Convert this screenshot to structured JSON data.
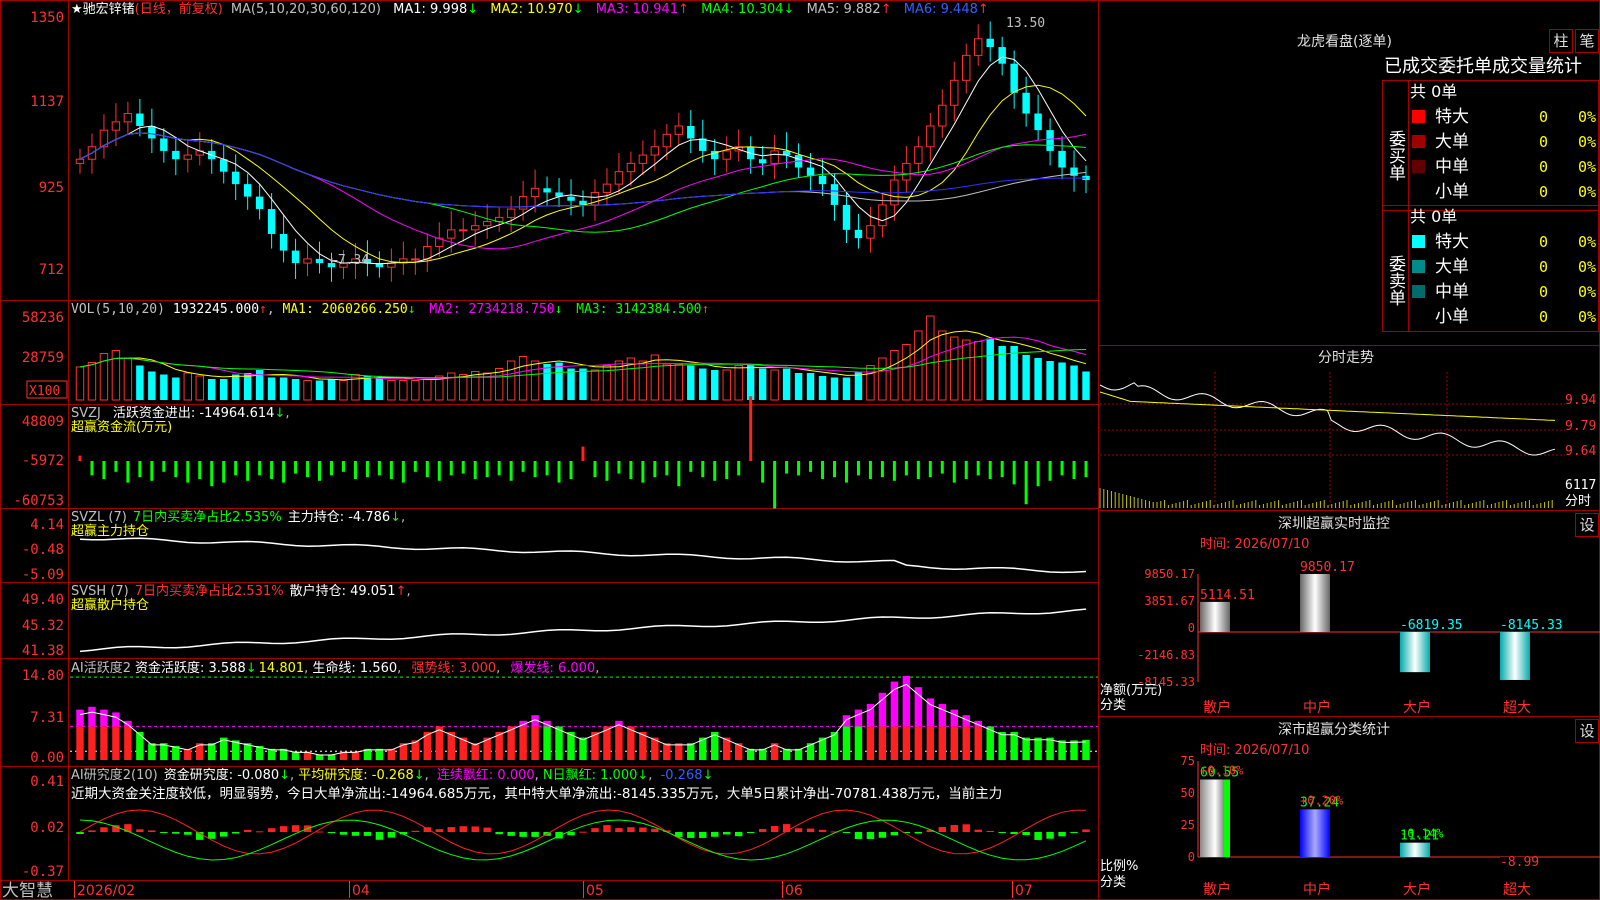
{
  "stock": {
    "title": "★驰宏锌锗",
    "period": "(日线，前复权)"
  },
  "main_panel": {
    "ma_label": "MA(5,10,20,30,60,120)",
    "ma": [
      {
        "label": "MA1: 9.998",
        "arrow": "↓",
        "color": "#ffffff"
      },
      {
        "label": "MA2: 10.970",
        "arrow": "↓",
        "color": "#ffff00"
      },
      {
        "label": "MA3: 10.941",
        "arrow": "↑",
        "color": "#ff00ff"
      },
      {
        "label": "MA4: 10.304",
        "arrow": "↓",
        "color": "#00ff00"
      },
      {
        "label": "MA5: 9.882",
        "arrow": "↑",
        "color": "#c0c0c0"
      },
      {
        "label": "MA6: 9.448",
        "arrow": "↑",
        "color": "#0000ff"
      }
    ],
    "y_ticks": [
      "1350",
      "1137",
      "925",
      "712"
    ],
    "high_label": "13.50",
    "low_label": "7.34"
  },
  "vol_panel": {
    "header": "VOL(5,10,20)",
    "value": "1932245.000",
    "ma": [
      {
        "label": "MA1: 2060266.250",
        "arrow": "↓",
        "color": "#ffff00"
      },
      {
        "label": "MA2: 2734218.750",
        "arrow": "↓",
        "color": "#ff00ff"
      },
      {
        "label": "MA3: 3142384.500",
        "arrow": "↑",
        "color": "#00ff00"
      }
    ],
    "y_ticks": [
      "58236",
      "28759"
    ],
    "unit": "X100"
  },
  "svzj_panel": {
    "header": "SVZJ",
    "label": "活跃资金进出: -14964.614",
    "arrow": "↓",
    "sub": "超赢资金流(万元)",
    "y_ticks": [
      "48809",
      "-5972",
      "-60753"
    ]
  },
  "svzl_panel": {
    "header": "SVZL (7)",
    "pct": "7日内买卖净占比2.535%",
    "label": "主力持仓: -4.786",
    "arrow": "↓",
    "sub": "超赢主力持仓",
    "y_ticks": [
      "4.14",
      "-0.48",
      "-5.09"
    ]
  },
  "svsh_panel": {
    "header": "SVSH (7)",
    "pct": "7日内买卖净占比2.531%",
    "label": "散户持仓: 49.051",
    "arrow": "↑",
    "sub": "超赢散户持仓",
    "y_ticks": [
      "49.40",
      "45.32",
      "41.38"
    ]
  },
  "ai_active_panel": {
    "header": "AI活跃度2",
    "label": "资金活跃度: 3.588",
    "arrow": "↓",
    "v2": "14.801",
    "life": "生命线: 1.560",
    "strong": "强势线: 3.000",
    "burst": "爆发线: 6.000",
    "y_ticks": [
      "14.80",
      "7.31",
      "0.00"
    ]
  },
  "ai_research_panel": {
    "header": "AI研究度2(10)",
    "label": "资金研究度: -0.080",
    "arrow": "↓",
    "avg": "平均研究度: -0.268",
    "lx": "连续飘红: 0.000",
    "nr": "N日飘红: 1.000",
    "last": "-0.268",
    "note": "近期大资金关注度较低，明显弱势，今日大单净流出:-14964.685万元，其中特大单净流出:-8145.335万元，大单5日累计净出-70781.438万元，当前主力",
    "y_ticks": [
      "0.41",
      "0.02",
      "-0.37"
    ]
  },
  "time_axis": {
    "brand": "大智慧",
    "labels": [
      "2026/02",
      "04",
      "05",
      "06",
      "07"
    ]
  },
  "right": {
    "lhb_title": "龙虎看盘(逐单)",
    "btn_bar": "柱",
    "btn_pen": "笔",
    "tabs": "已成交委托单成交量统计",
    "buy": {
      "side": "委买单",
      "total": "共 0单",
      "rows": [
        {
          "name": "特大",
          "v": "0",
          "p": "0%",
          "color": "#ff0000"
        },
        {
          "name": "大单",
          "v": "0",
          "p": "0%",
          "color": "#a00000"
        },
        {
          "name": "中单",
          "v": "0",
          "p": "0%",
          "color": "#600000"
        },
        {
          "name": "小单",
          "v": "0",
          "p": "0%",
          "color": "#000000"
        }
      ]
    },
    "sell": {
      "side": "委卖单",
      "total": "共 0单",
      "rows": [
        {
          "name": "特大",
          "v": "0",
          "p": "0%",
          "color": "#00ffff"
        },
        {
          "name": "大单",
          "v": "0",
          "p": "0%",
          "color": "#008b8b"
        },
        {
          "name": "中单",
          "v": "0",
          "p": "0%",
          "color": "#006b6b"
        },
        {
          "name": "小单",
          "v": "0",
          "p": "0%",
          "color": "#000000"
        }
      ]
    },
    "intraday": {
      "title": "分时走势",
      "ticks": [
        "9.94",
        "9.79",
        "9.64"
      ],
      "vol_label": "6117",
      "time_label": "分时"
    },
    "sz_monitor": {
      "title": "深圳超赢实时监控",
      "btn": "设",
      "time": "时间: 2026/07/10",
      "y_ticks": [
        "9850.17",
        "3851.67",
        "0",
        "-2146.83",
        "-8145.33"
      ],
      "axis_label": "净额(万元)",
      "cat_label": "分类",
      "cats": [
        "散户",
        "中户",
        "大户",
        "超大"
      ],
      "values": [
        5114.51,
        9850.17,
        -6819.35,
        -8145.33
      ],
      "value_labels": [
        "5114.51",
        "9850.17",
        "-6819.35",
        "-8145.33"
      ]
    },
    "sz_class": {
      "title": "深市超赢分类统计",
      "btn": "设",
      "time": "时间: 2026/07/10",
      "y_ticks": [
        "75",
        "50",
        "25",
        "0"
      ],
      "axis_label": "比例%",
      "cat_label": "分类",
      "cats": [
        "散户",
        "中户",
        "大户",
        "超大"
      ],
      "values": [
        60.55,
        37.24,
        11.21,
        -8.99
      ],
      "value_labels": [
        "60.55",
        "37.24",
        "11.21",
        "-8.99"
      ],
      "changes": [
        "+0.10%",
        "+0.20%",
        "-0.14%",
        ""
      ]
    }
  },
  "chart_data": {
    "type": "candlestick",
    "title": "驰宏锌锗 日线",
    "x_labels": [
      "2026/02",
      "04",
      "05",
      "06",
      "07"
    ],
    "price_range": [
      7.12,
      13.5
    ],
    "high": 13.5,
    "low": 7.34,
    "close_series": [
      10.1,
      10.4,
      10.8,
      11.0,
      11.2,
      10.9,
      10.6,
      10.3,
      10.1,
      10.2,
      10.3,
      10.1,
      9.8,
      9.5,
      9.2,
      8.9,
      8.3,
      7.9,
      7.6,
      7.7,
      7.6,
      7.5,
      7.6,
      7.7,
      7.6,
      7.5,
      7.6,
      7.7,
      7.7,
      8.0,
      8.2,
      8.4,
      8.4,
      8.5,
      8.6,
      8.7,
      8.9,
      9.2,
      9.4,
      9.3,
      9.2,
      9.1,
      9.0,
      9.3,
      9.5,
      9.8,
      10.0,
      10.2,
      10.4,
      10.7,
      10.9,
      10.6,
      10.3,
      10.1,
      10.3,
      10.4,
      10.1,
      10.0,
      10.3,
      10.2,
      9.9,
      9.7,
      9.5,
      9.0,
      8.4,
      8.2,
      8.5,
      9.0,
      9.6,
      10.0,
      10.4,
      10.9,
      11.4,
      12.0,
      12.6,
      13.0,
      12.8,
      12.4,
      11.7,
      11.2,
      10.8,
      10.3,
      9.9,
      9.7,
      9.6
    ],
    "volume": [
      2.2,
      2.5,
      3.1,
      3.3,
      2.8,
      2.3,
      1.9,
      1.7,
      1.5,
      1.8,
      1.6,
      1.4,
      1.4,
      1.7,
      1.8,
      2.0,
      1.5,
      1.5,
      1.4,
      1.3,
      1.3,
      1.4,
      1.3,
      1.7,
      1.6,
      1.5,
      1.3,
      1.3,
      1.3,
      1.4,
      1.6,
      1.8,
      1.7,
      1.9,
      1.8,
      2.1,
      2.6,
      2.9,
      2.6,
      2.4,
      2.5,
      2.1,
      2.1,
      2.0,
      2.3,
      2.6,
      2.8,
      2.6,
      3.0,
      2.4,
      2.4,
      2.3,
      2.1,
      2.0,
      2.0,
      2.3,
      2.4,
      2.1,
      2.0,
      2.1,
      1.8,
      1.8,
      1.6,
      1.5,
      1.5,
      1.9,
      2.3,
      2.8,
      3.3,
      3.7,
      4.6,
      5.6,
      4.6,
      4.2,
      4.0,
      3.9,
      4.1,
      3.6,
      3.6,
      3.0,
      2.8,
      2.6,
      2.5,
      2.3,
      1.9
    ],
    "svzj": [
      3,
      -8,
      -10,
      -6,
      -12,
      -9,
      -11,
      -6,
      -9,
      -12,
      -10,
      -14,
      -12,
      -8,
      -11,
      -8,
      -10,
      -12,
      -7,
      -9,
      -11,
      -8,
      -6,
      -10,
      -9,
      -8,
      -10,
      -12,
      -6,
      -9,
      -11,
      -8,
      -7,
      -10,
      -9,
      -8,
      -11,
      -6,
      -9,
      -8,
      -12,
      -10,
      8,
      -9,
      -11,
      -7,
      -10,
      -12,
      -9,
      -8,
      -14,
      -6,
      -9,
      -11,
      -10,
      -8,
      30,
      -12,
      -22,
      -7,
      -8,
      -6,
      -10,
      -9,
      -12,
      -8,
      -10,
      -9,
      -11,
      -8,
      -10,
      -9,
      -7,
      -12,
      -10,
      -8,
      -10,
      -9,
      -13,
      -20,
      -14,
      -11,
      -8,
      -10,
      -9
    ],
    "ai_activity": [
      9,
      9.5,
      9,
      8.5,
      7,
      5,
      3,
      3,
      2.5,
      2,
      3,
      3,
      4,
      3.5,
      3,
      2.5,
      2,
      2,
      1.5,
      1.5,
      1,
      1,
      1.5,
      1.5,
      2,
      2,
      2,
      3,
      3.5,
      5,
      6,
      5,
      4,
      3,
      4,
      5,
      6,
      7,
      8,
      7,
      6,
      5,
      4,
      5,
      6,
      7,
      6,
      5,
      4,
      3,
      3,
      3,
      4,
      5,
      4,
      3,
      2,
      2,
      3,
      2,
      2,
      3,
      4,
      5,
      8,
      9,
      10,
      12,
      14,
      15,
      13,
      11,
      10,
      9,
      8,
      7,
      6,
      5,
      5,
      4,
      4,
      4,
      3.5,
      3.5,
      3.6
    ]
  }
}
